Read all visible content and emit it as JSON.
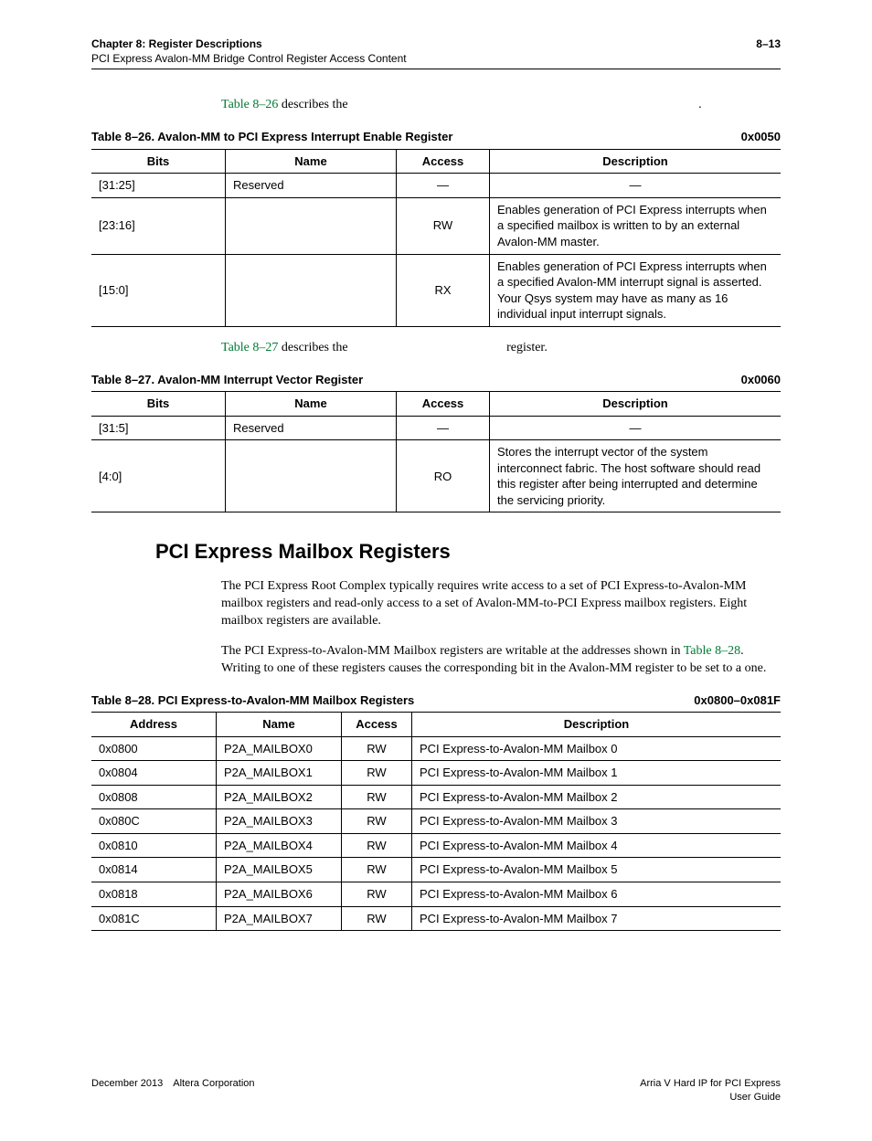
{
  "header": {
    "chapter": "Chapter 8: Register Descriptions",
    "subtitle": "PCI Express Avalon-MM Bridge Control Register Access Content",
    "pageno": "8–13"
  },
  "intro26_link": "Table 8–26",
  "intro26_text": " describes the ",
  "intro26_trail": ".",
  "table26": {
    "caption_left": "Table 8–26. Avalon-MM to PCI Express Interrupt Enable Register",
    "caption_right": "0x0050",
    "headers": {
      "bits": "Bits",
      "name": "Name",
      "access": "Access",
      "desc": "Description"
    },
    "rows": [
      {
        "bits": "[31:25]",
        "name": "Reserved",
        "access": "—",
        "desc": "—"
      },
      {
        "bits": "[23:16]",
        "name": "",
        "access": "RW",
        "desc": "Enables generation of PCI Express interrupts when a specified mailbox is written to by an external Avalon-MM master."
      },
      {
        "bits": "[15:0]",
        "name": "",
        "access": "RX",
        "desc": "Enables generation of PCI Express interrupts when a specified Avalon-MM interrupt signal is asserted. Your Qsys system may have as many as 16 individual input interrupt signals."
      }
    ]
  },
  "intro27_link": "Table 8–27",
  "intro27_text": " describes the ",
  "intro27_mid": "",
  "intro27_trail": "register.",
  "table27": {
    "caption_left": "Table 8–27. Avalon-MM Interrupt Vector Register",
    "caption_right": "0x0060",
    "headers": {
      "bits": "Bits",
      "name": "Name",
      "access": "Access",
      "desc": "Description"
    },
    "rows": [
      {
        "bits": "[31:5]",
        "name": "Reserved",
        "access": "—",
        "desc": "—"
      },
      {
        "bits": "[4:0]",
        "name": "",
        "access": "RO",
        "desc": "Stores the interrupt vector of the system interconnect fabric. The host software should read this register after being interrupted and determine the servicing priority."
      }
    ]
  },
  "section_title": "PCI Express Mailbox Registers",
  "para1": "The PCI Express Root Complex typically requires write access to a set of PCI Express-to-Avalon-MM mailbox registers and read-only access to a set of Avalon-MM-to-PCI Express mailbox registers. Eight mailbox registers are available.",
  "para2_pre": "The PCI Express-to-Avalon-MM Mailbox registers are writable at the addresses shown in ",
  "para2_link": "Table 8–28",
  "para2_post": ". Writing to one of these registers causes the corresponding bit in the Avalon-MM register to be set to a one.",
  "table28": {
    "caption_left": "Table 8–28. PCI Express-to-Avalon-MM Mailbox Registers",
    "caption_right": "0x0800–0x081F",
    "headers": {
      "addr": "Address",
      "name": "Name",
      "access": "Access",
      "desc": "Description"
    },
    "rows": [
      {
        "addr": "0x0800",
        "name": "P2A_MAILBOX0",
        "access": "RW",
        "desc": "PCI Express-to-Avalon-MM Mailbox 0"
      },
      {
        "addr": "0x0804",
        "name": "P2A_MAILBOX1",
        "access": "RW",
        "desc": "PCI Express-to-Avalon-MM Mailbox 1"
      },
      {
        "addr": "0x0808",
        "name": "P2A_MAILBOX2",
        "access": "RW",
        "desc": "PCI Express-to-Avalon-MM Mailbox 2"
      },
      {
        "addr": "0x080C",
        "name": "P2A_MAILBOX3",
        "access": "RW",
        "desc": "PCI Express-to-Avalon-MM Mailbox 3"
      },
      {
        "addr": "0x0810",
        "name": "P2A_MAILBOX4",
        "access": "RW",
        "desc": "PCI Express-to-Avalon-MM Mailbox 4"
      },
      {
        "addr": "0x0814",
        "name": "P2A_MAILBOX5",
        "access": "RW",
        "desc": "PCI Express-to-Avalon-MM Mailbox 5"
      },
      {
        "addr": "0x0818",
        "name": "P2A_MAILBOX6",
        "access": "RW",
        "desc": "PCI Express-to-Avalon-MM Mailbox 6"
      },
      {
        "addr": "0x081C",
        "name": "P2A_MAILBOX7",
        "access": "RW",
        "desc": "PCI Express-to-Avalon-MM Mailbox 7"
      }
    ]
  },
  "footer": {
    "left": "December 2013 Altera Corporation",
    "right1": "Arria V Hard IP for PCI Express",
    "right2": "User Guide"
  }
}
